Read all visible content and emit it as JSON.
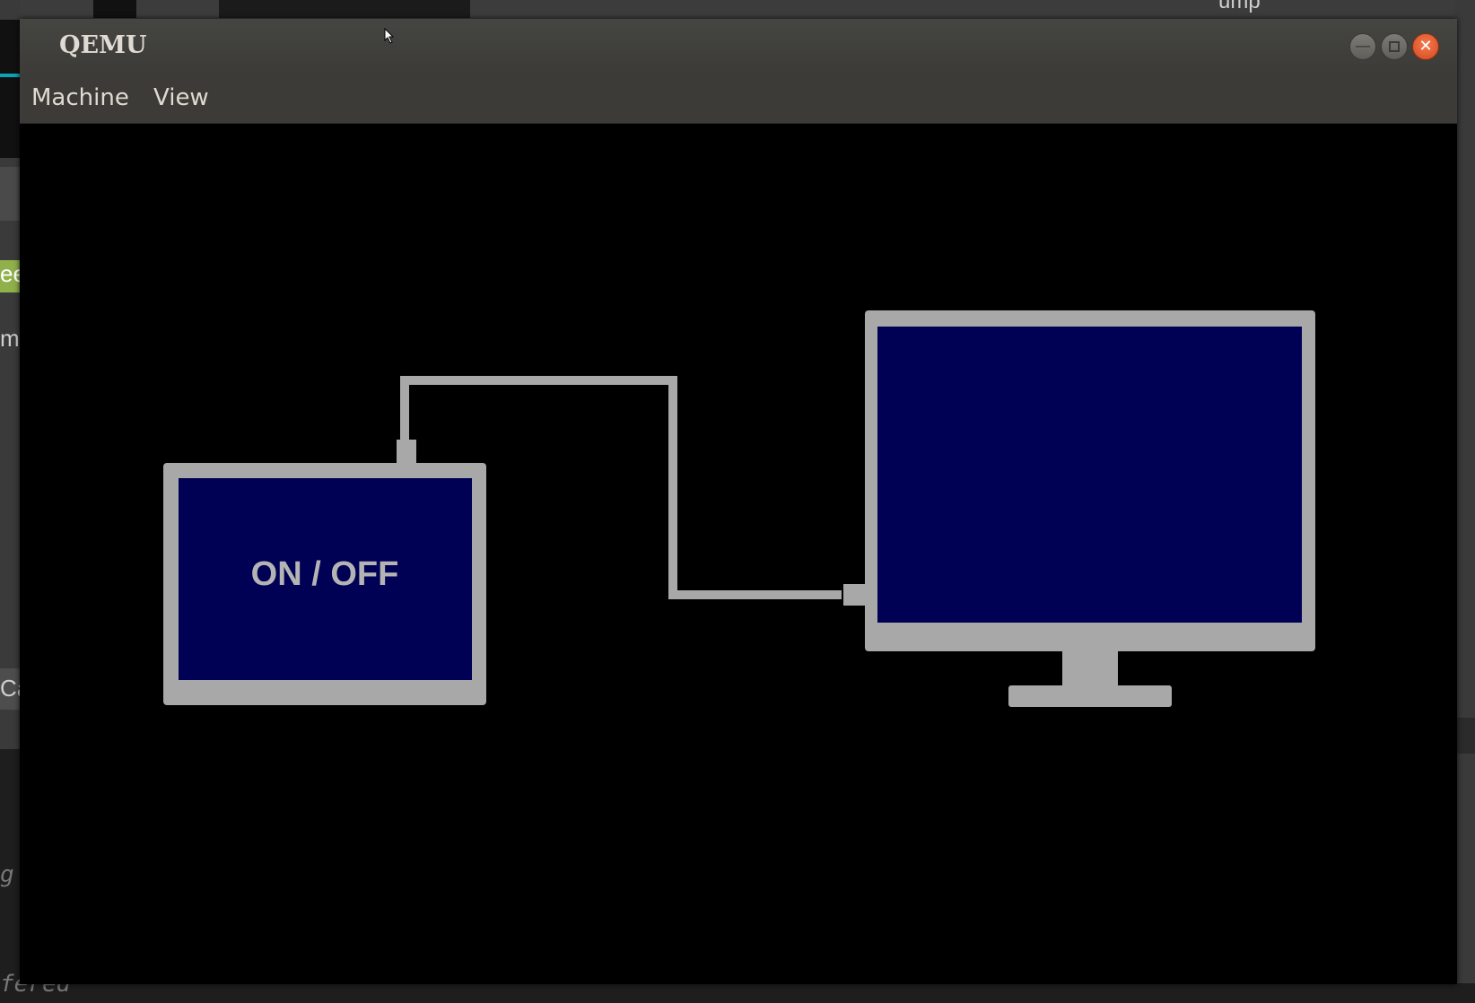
{
  "window": {
    "title": "QEMU",
    "controls": {
      "minimize": "minimize-icon",
      "maximize": "maximize-icon",
      "close": "close-icon"
    }
  },
  "menubar": {
    "items": [
      "Machine",
      "View"
    ]
  },
  "display": {
    "background": "#000000",
    "panel_color": "#000055",
    "frame_color": "#a8a8a8",
    "switch_label": "ON / OFF"
  },
  "background_fragments": {
    "left_texts": [
      "ee",
      "m",
      "Ca"
    ],
    "bottom_italic": [
      "g",
      "fered"
    ],
    "top_right_text": "ump"
  },
  "colors": {
    "titlebar": "#3c3b37",
    "title_text": "#dfdbd2",
    "close_button": "#e0532a"
  }
}
